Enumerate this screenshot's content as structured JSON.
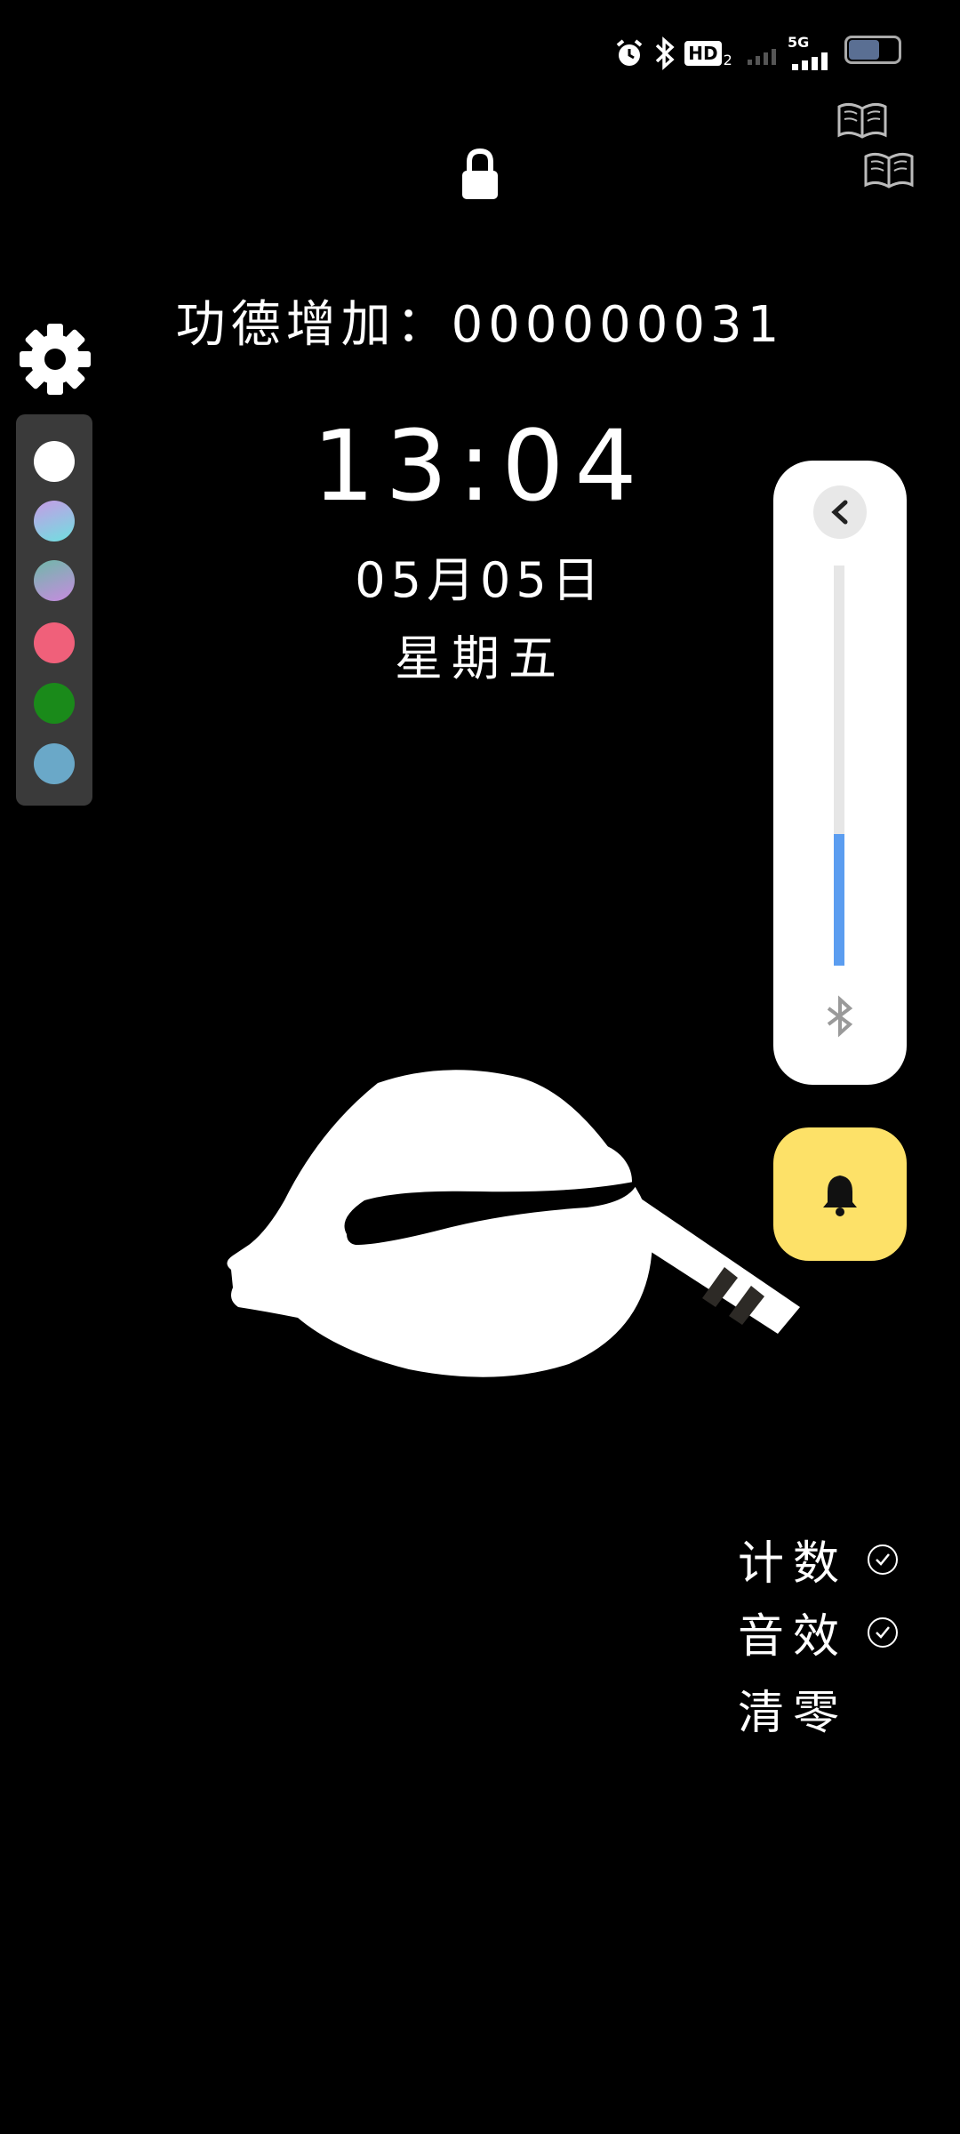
{
  "status_bar": {
    "icons": [
      "alarm-icon",
      "bluetooth-icon",
      "hd-icon",
      "signal-icon",
      "5g-signal-icon",
      "battery-icon"
    ],
    "hd_label": "HD",
    "hd_sub": "2",
    "network_label": "5G"
  },
  "counter": {
    "label": "功德增加：",
    "value": "000000031"
  },
  "clock": {
    "time": "13:04",
    "date": "05月05日",
    "weekday": "星期五"
  },
  "palette": {
    "colors": [
      "#ffffff",
      "#9fd7e8",
      "#8ab5c8",
      "#f0607a",
      "#1a8a1a",
      "#6aa8c8"
    ]
  },
  "volume": {
    "level": 0.33,
    "fill_color": "#5b9df0"
  },
  "options": {
    "count_label": "计数",
    "sound_label": "音效",
    "reset_label": "清零"
  },
  "colors": {
    "bell_button": "#fde168",
    "background": "#000000"
  }
}
